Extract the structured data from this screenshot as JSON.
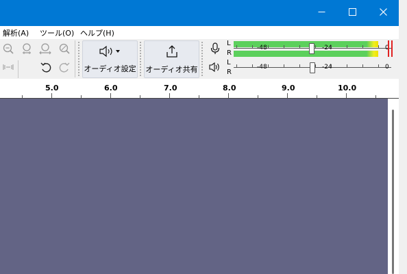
{
  "window": {
    "controls": [
      "minimize",
      "maximize",
      "close"
    ]
  },
  "menubar": {
    "items": [
      {
        "label": "解析(A)"
      },
      {
        "label": "ツール(O)"
      },
      {
        "label": "ヘルプ(H)"
      }
    ]
  },
  "toolbar": {
    "zoom_buttons": [
      "zoom-out-icon",
      "zoom-selection-icon",
      "zoom-fit-icon",
      "zoom-toggle-icon"
    ],
    "audio_setup_label": "オーディオ設定",
    "share_audio_label": "オーディオ共有"
  },
  "meters": {
    "record": {
      "channels": [
        "L",
        "R"
      ],
      "scale": [
        "-48",
        "-24",
        "0"
      ],
      "level_fraction": 0.94
    },
    "playback": {
      "channels": [
        "L",
        "R"
      ],
      "scale": [
        "-48",
        "-24",
        "0"
      ]
    }
  },
  "ruler": {
    "labels": [
      "5.0",
      "6.0",
      "7.0",
      "8.0",
      "9.0",
      "10.0"
    ]
  },
  "colors": {
    "titlebar": "#0078d4",
    "track_background": "#636485",
    "meter_green": "#5cd05c",
    "meter_yellow": "#f0ef20",
    "clip_red": "#e02020"
  }
}
